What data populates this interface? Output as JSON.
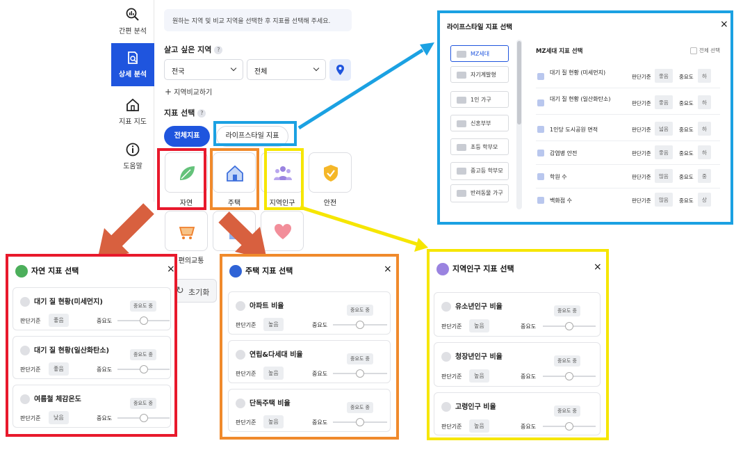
{
  "nav": {
    "items": [
      {
        "label": "간편 분석",
        "icon": "search-chart-icon",
        "active": false
      },
      {
        "label": "상세 분석",
        "icon": "document-search-icon",
        "active": true
      },
      {
        "label": "지표 지도",
        "icon": "home-map-icon",
        "active": false
      },
      {
        "label": "도움말",
        "icon": "info-icon",
        "active": false
      }
    ]
  },
  "main": {
    "notice": "원하는 지역 및 비교 지역을 선택한 후 지표를 선택해 주세요.",
    "region_title": "살고 싶은 지역",
    "help_mark": "?",
    "select_province": "전국",
    "select_district": "전체",
    "compare_link": "지역비교하기",
    "indicator_title": "지표 선택",
    "tab_all": "전체지표",
    "tab_lifestyle": "라이프스타일 지표",
    "tiles": [
      {
        "label": "자연",
        "icon": "leaf-icon"
      },
      {
        "label": "주택",
        "icon": "house-icon"
      },
      {
        "label": "지역인구",
        "icon": "people-icon"
      },
      {
        "label": "안전",
        "icon": "shield-icon"
      },
      {
        "label": "편의교통",
        "icon": "cart-icon"
      },
      {
        "label": "",
        "icon": "building-icon"
      },
      {
        "label": "",
        "icon": "heart-icon"
      }
    ],
    "reset": "초기화"
  },
  "colors": {
    "accent": "#1f55de",
    "frame_red": "#e8192c",
    "frame_orange": "#f08a2c",
    "frame_yellow": "#f6e600",
    "frame_blue": "#1ba1e2",
    "arrow_red": "#d8603f"
  },
  "nature_modal": {
    "title": "자연 지표 선택",
    "close": "×",
    "cards": [
      {
        "title": "대기 질 현황(미세먼지)",
        "criterion_label": "판단기준",
        "criterion": "좋음",
        "importance_label": "중요도",
        "badge": "중요도 중",
        "level": 0.5
      },
      {
        "title": "대기 질 현황(일산화탄소)",
        "criterion_label": "판단기준",
        "criterion": "좋음",
        "importance_label": "중요도",
        "badge": "중요도 중",
        "level": 0.5
      },
      {
        "title": "여름철 체감온도",
        "criterion_label": "판단기준",
        "criterion": "낮음",
        "importance_label": "중요도",
        "badge": "중요도 중",
        "level": 0.5
      }
    ]
  },
  "housing_modal": {
    "title": "주택 지표 선택",
    "close": "×",
    "cards": [
      {
        "title": "아파트 비율",
        "criterion_label": "판단기준",
        "criterion": "높음",
        "importance_label": "중요도",
        "badge": "중요도 중",
        "level": 0.5
      },
      {
        "title": "연립&다세대 비율",
        "criterion_label": "판단기준",
        "criterion": "높음",
        "importance_label": "중요도",
        "badge": "중요도 중",
        "level": 0.5
      },
      {
        "title": "단독주택 비율",
        "criterion_label": "판단기준",
        "criterion": "높음",
        "importance_label": "중요도",
        "badge": "중요도 중",
        "level": 0.5
      }
    ]
  },
  "population_modal": {
    "title": "지역인구 지표 선택",
    "close": "×",
    "cards": [
      {
        "title": "유소년인구 비율",
        "criterion_label": "판단기준",
        "criterion": "높음",
        "importance_label": "중요도",
        "badge": "중요도 중",
        "level": 0.5
      },
      {
        "title": "청장년인구 비율",
        "criterion_label": "판단기준",
        "criterion": "높음",
        "importance_label": "중요도",
        "badge": "중요도 중",
        "level": 0.5
      },
      {
        "title": "고령인구 비율",
        "criterion_label": "판단기준",
        "criterion": "높음",
        "importance_label": "중요도",
        "badge": "중요도 중",
        "level": 0.5
      }
    ]
  },
  "lifestyle_modal": {
    "title": "라이프스타일 지표 선택",
    "close": "×",
    "sidebar": [
      "MZ세대",
      "자기계발형",
      "1인 가구",
      "신혼부부",
      "초등 학부모",
      "중고등 학부모",
      "반려동물 가구"
    ],
    "section_title": "MZ세대 지표 선택",
    "select_all": "전체 선택",
    "rows": [
      {
        "label": "대기 질 현황 (미세먼지)",
        "criterion_label": "판단기준",
        "criterion": "좋음",
        "importance_label": "중요도",
        "importance": "하"
      },
      {
        "label": "대기 질 현황 (일산화탄소)",
        "criterion_label": "판단기준",
        "criterion": "좋음",
        "importance_label": "중요도",
        "importance": "하"
      },
      {
        "label": "1인당 도시공원 면적",
        "criterion_label": "판단기준",
        "criterion": "넓음",
        "importance_label": "중요도",
        "importance": "하"
      },
      {
        "label": "감염병 안전",
        "criterion_label": "판단기준",
        "criterion": "좋음",
        "importance_label": "중요도",
        "importance": "하"
      },
      {
        "label": "학원 수",
        "criterion_label": "판단기준",
        "criterion": "많음",
        "importance_label": "중요도",
        "importance": "중"
      },
      {
        "label": "백화점 수",
        "criterion_label": "판단기준",
        "criterion": "많음",
        "importance_label": "중요도",
        "importance": "상"
      }
    ]
  }
}
